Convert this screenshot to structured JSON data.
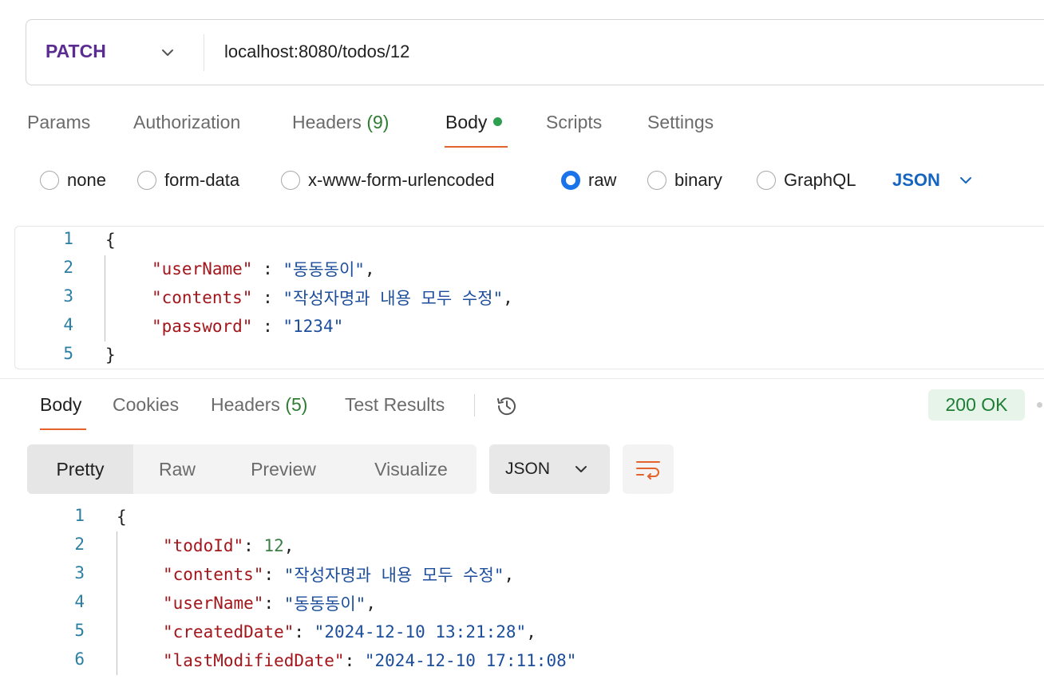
{
  "request": {
    "method": "PATCH",
    "url": "localhost:8080/todos/12",
    "tabs": [
      {
        "label": "Params"
      },
      {
        "label": "Authorization"
      },
      {
        "label": "Headers",
        "count": "(9)"
      },
      {
        "label": "Body"
      },
      {
        "label": "Scripts"
      },
      {
        "label": "Settings"
      }
    ],
    "active_tab": "Body",
    "body_types": [
      "none",
      "form-data",
      "x-www-form-urlencoded",
      "raw",
      "binary",
      "GraphQL"
    ],
    "selected_body_type": "raw",
    "raw_format": "JSON",
    "body_lines": [
      {
        "n": "1",
        "open": "{"
      },
      {
        "n": "2",
        "key": "\"userName\"",
        "sep": " : ",
        "value": "\"동동동이\"",
        "end": ","
      },
      {
        "n": "3",
        "key": "\"contents\"",
        "sep": " : ",
        "value": "\"작성자명과 내용 모두 수정\"",
        "end": ","
      },
      {
        "n": "4",
        "key": "\"password\"",
        "sep": " : ",
        "value": "\"1234\"",
        "end": ""
      },
      {
        "n": "5",
        "close": "}"
      }
    ]
  },
  "response": {
    "tabs": [
      {
        "label": "Body"
      },
      {
        "label": "Cookies"
      },
      {
        "label": "Headers",
        "count": "(5)"
      },
      {
        "label": "Test Results"
      }
    ],
    "active_tab": "Body",
    "status": "200 OK",
    "view_modes": [
      "Pretty",
      "Raw",
      "Preview",
      "Visualize"
    ],
    "active_view": "Pretty",
    "format": "JSON",
    "body_lines": [
      {
        "n": "1",
        "open": "{"
      },
      {
        "n": "2",
        "key": "\"todoId\"",
        "sep": ": ",
        "value": "12",
        "end": ","
      },
      {
        "n": "3",
        "key": "\"contents\"",
        "sep": ": ",
        "value": "\"작성자명과 내용 모두 수정\"",
        "end": ","
      },
      {
        "n": "4",
        "key": "\"userName\"",
        "sep": ": ",
        "value": "\"동동동이\"",
        "end": ","
      },
      {
        "n": "5",
        "key": "\"createdDate\"",
        "sep": ": ",
        "value": "\"2024-12-10 13:21:28\"",
        "end": ","
      },
      {
        "n": "6",
        "key": "\"lastModifiedDate\"",
        "sep": ": ",
        "value": "\"2024-12-10 17:11:08\"",
        "end": ""
      }
    ]
  },
  "icons": {
    "method_dropdown": "chevron-down-icon",
    "format_dropdown": "chevron-down-icon",
    "history": "history-icon",
    "wrap": "wrap-lines-icon"
  },
  "colors": {
    "method": "#5b2d91",
    "active_tab_underline": "#e4622c",
    "body_dot": "#2e9e4f",
    "radio_checked": "#1a73e8",
    "json_key": "#a3161b",
    "json_string": "#1c4e9c",
    "json_number": "#3b7f46",
    "status_ok_bg": "#e6f4ea",
    "status_ok_text": "#1e7e34"
  }
}
